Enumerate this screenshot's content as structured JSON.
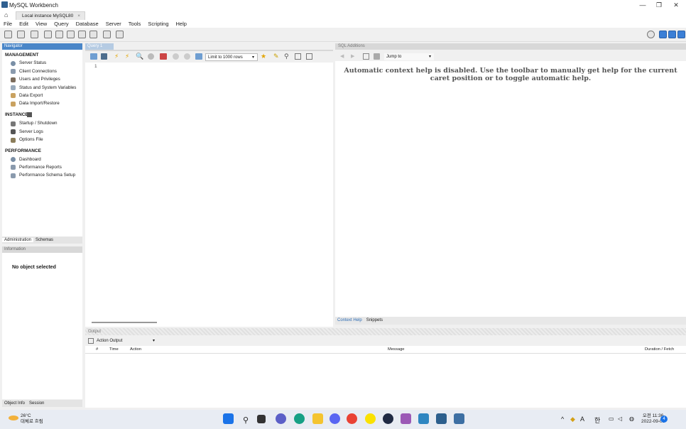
{
  "window": {
    "title": "MySQL Workbench",
    "min": "—",
    "restore": "❐",
    "close": "✕"
  },
  "conn_tab": {
    "label": "Local instance MySQL80",
    "close": "×"
  },
  "menu": [
    "File",
    "Edit",
    "View",
    "Query",
    "Database",
    "Server",
    "Tools",
    "Scripting",
    "Help"
  ],
  "navigator": {
    "header": "Navigator",
    "management": {
      "title": "MANAGEMENT",
      "items": [
        "Server Status",
        "Client Connections",
        "Users and Privileges",
        "Status and System Variables",
        "Data Export",
        "Data Import/Restore"
      ]
    },
    "instance": {
      "title": "INSTANCE",
      "items": [
        "Startup / Shutdown",
        "Server Logs",
        "Options File"
      ]
    },
    "performance": {
      "title": "PERFORMANCE",
      "items": [
        "Dashboard",
        "Performance Reports",
        "Performance Schema Setup"
      ]
    },
    "tabs": [
      "Administration",
      "Schemas"
    ]
  },
  "info": {
    "header": "Information",
    "empty": "No object selected",
    "tabs": [
      "Object Info",
      "Session"
    ]
  },
  "query": {
    "tab": "Query 1",
    "line": "1",
    "limit": "Limit to 1000 rows"
  },
  "sql_additions": {
    "header": "SQL Additions",
    "jump": "Jump to",
    "help": "Automatic context help is disabled. Use the toolbar to manually get help for the current caret position or to toggle automatic help.",
    "tabs": [
      "Context Help",
      "Snippets"
    ]
  },
  "output": {
    "header": "Output",
    "select": "Action Output",
    "columns": [
      "#",
      "Time",
      "Action",
      "Message",
      "Duration / Fetch"
    ]
  },
  "taskbar": {
    "temp": "26°C",
    "weather": "대체로 흐림",
    "ime": "A",
    "lang": "한",
    "time": "오전 11:36",
    "date": "2022-09-03",
    "badge": "4"
  }
}
